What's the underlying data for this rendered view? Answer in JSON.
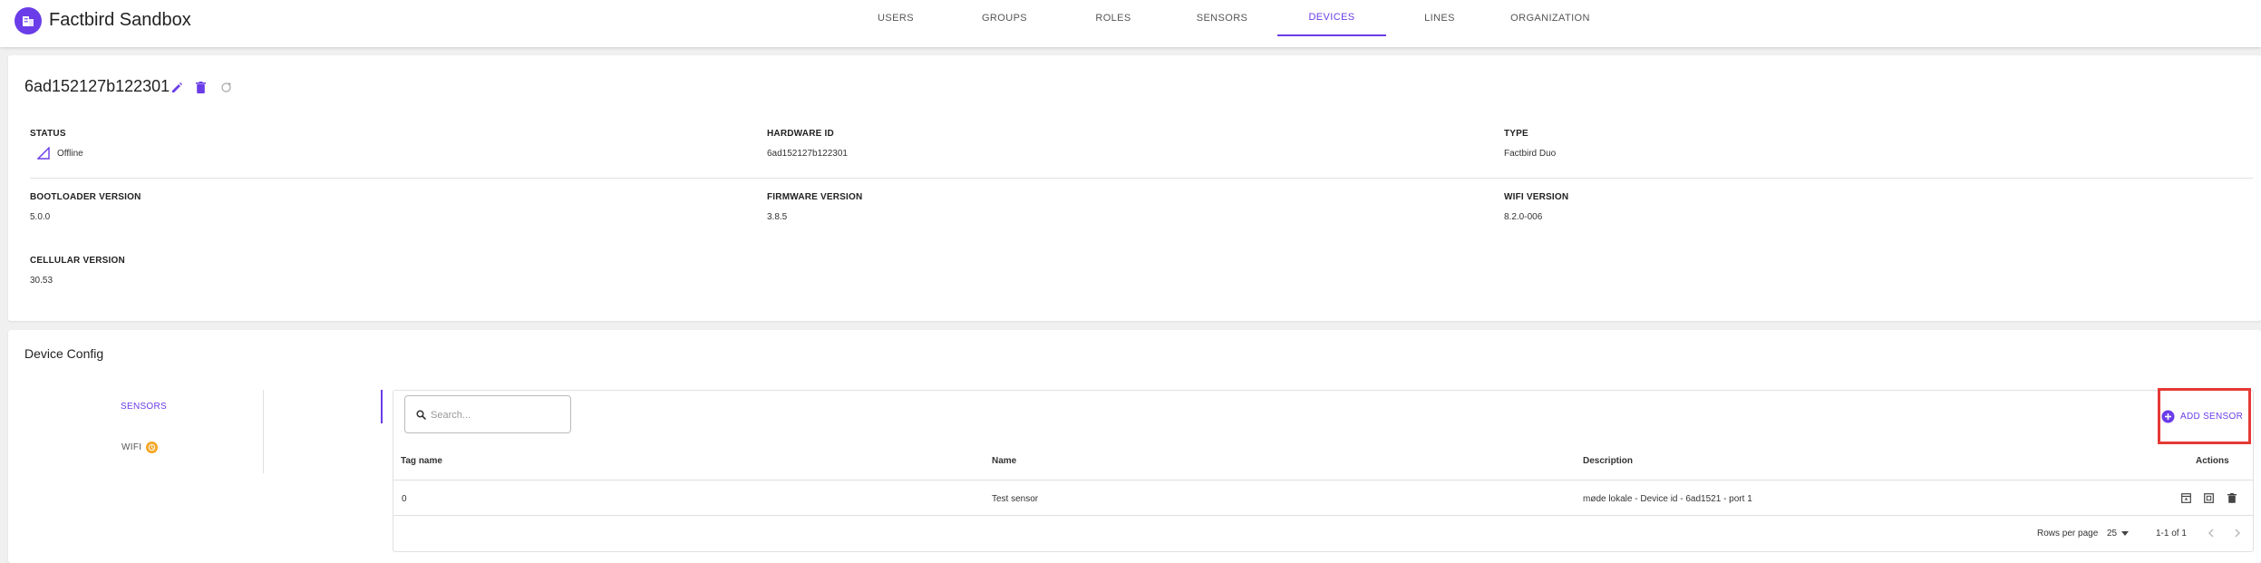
{
  "app": {
    "title": "Factbird Sandbox"
  },
  "nav": {
    "tabs": [
      {
        "label": "USERS"
      },
      {
        "label": "GROUPS"
      },
      {
        "label": "ROLES"
      },
      {
        "label": "SENSORS"
      },
      {
        "label": "DEVICES",
        "active": true
      },
      {
        "label": "LINES"
      },
      {
        "label": "ORGANIZATION"
      }
    ]
  },
  "device": {
    "title": "6ad152127b122301",
    "icons": [
      "edit-icon",
      "delete-icon",
      "refresh-icon"
    ],
    "fields": {
      "status": {
        "label": "STATUS",
        "value": "Offline",
        "icon": "signal-off-icon"
      },
      "hardware_id": {
        "label": "HARDWARE ID",
        "value": "6ad152127b122301"
      },
      "type": {
        "label": "TYPE",
        "value": "Factbird Duo"
      },
      "bootloader_version": {
        "label": "BOOTLOADER VERSION",
        "value": "5.0.0"
      },
      "firmware_version": {
        "label": "FIRMWARE VERSION",
        "value": "3.8.5"
      },
      "wifi_version": {
        "label": "WIFI VERSION",
        "value": "8.2.0-006"
      },
      "cellular_version": {
        "label": "CELLULAR VERSION",
        "value": "30.53"
      }
    }
  },
  "config": {
    "title": "Device Config",
    "tabs": [
      {
        "label": "SENSORS",
        "active": true
      },
      {
        "label": "WIFI",
        "badge_icon": "warning-icon"
      }
    ],
    "search": {
      "placeholder": "Search...",
      "value": ""
    },
    "add_button": "ADD SENSOR",
    "table": {
      "columns": [
        "Tag name",
        "Name",
        "Description",
        "Actions"
      ],
      "rows": [
        {
          "tag": "0",
          "name": "Test sensor",
          "description": "møde lokale - Device id - 6ad1521 - port 1",
          "actions": [
            "open-icon",
            "expand-icon",
            "delete-icon"
          ]
        }
      ]
    },
    "pagination": {
      "rows_per_page_label": "Rows per page",
      "rows_per_page": "25",
      "range": "1-1 of 1"
    }
  },
  "colors": {
    "accent": "#6a3de8",
    "warning": "#f5a623",
    "highlight": "#e53935"
  }
}
